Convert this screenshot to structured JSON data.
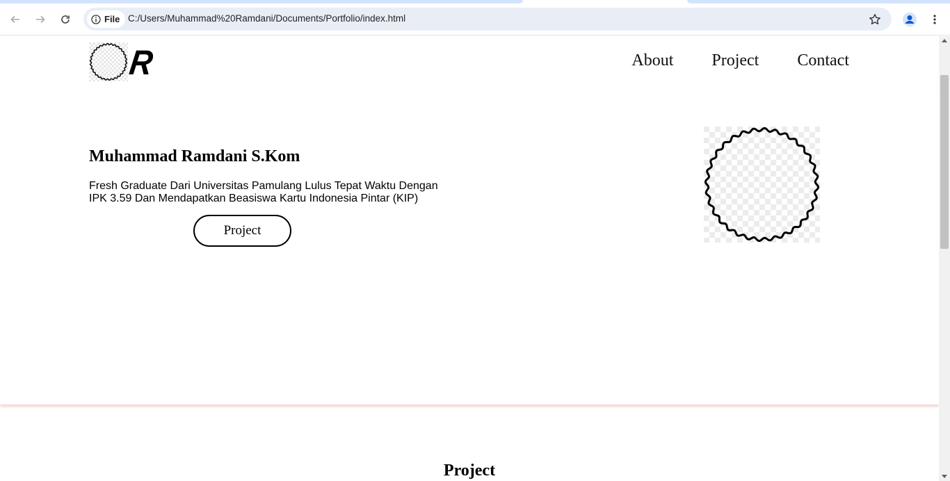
{
  "browser": {
    "site_info_label": "File",
    "url": "C:/Users/Muhammad%20Ramdani/Documents/Portfolio/index.html"
  },
  "nav": {
    "logo_letter": "R",
    "links": [
      "About",
      "Project",
      "Contact"
    ]
  },
  "hero": {
    "title": "Muhammad Ramdani S.Kom",
    "description": "Fresh Graduate Dari Universitas Pamulang Lulus Tepat Waktu Dengan IPK 3.59 Dan Mendapatkan Beasiswa Kartu Indonesia Pintar (KIP)",
    "button_label": "Project"
  },
  "projects": {
    "title": "Project"
  },
  "colors": {
    "omnibox_bg": "#e9eef6",
    "tab_accent": "#d3e3fd",
    "profile_blue": "#0b57d0"
  }
}
